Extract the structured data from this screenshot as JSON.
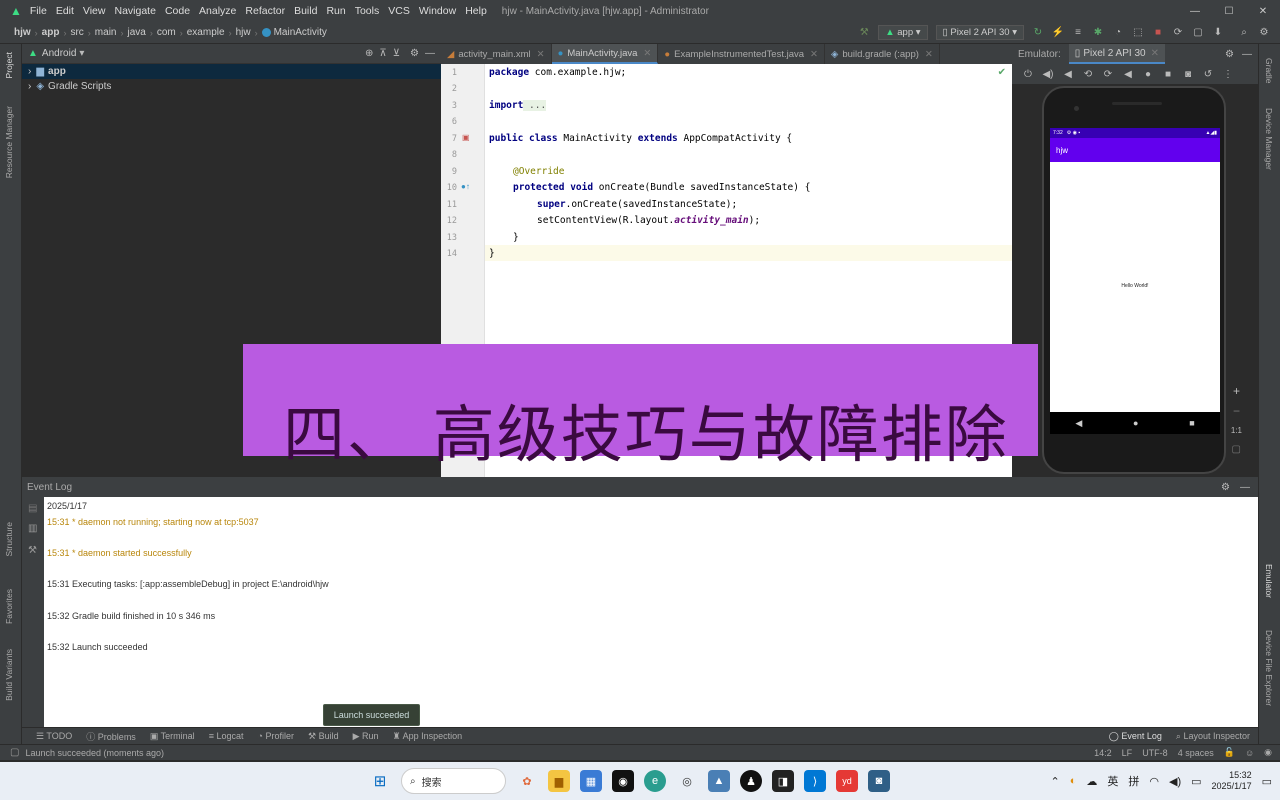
{
  "window": {
    "title": "hjw - MainActivity.java [hjw.app] - Administrator",
    "menu": [
      "File",
      "Edit",
      "View",
      "Navigate",
      "Code",
      "Analyze",
      "Refactor",
      "Build",
      "Run",
      "Tools",
      "VCS",
      "Window",
      "Help"
    ],
    "min": "—",
    "max": "☐",
    "close": "✕"
  },
  "breadcrumb": [
    "hjw",
    "app",
    "src",
    "main",
    "java",
    "com",
    "example",
    "hjw",
    "MainActivity"
  ],
  "toolbar": {
    "config": "app",
    "device": "Pixel 2 API 30"
  },
  "left_tabs": [
    "Project",
    "Resource Manager",
    "Structure",
    "Favorites",
    "Build Variants"
  ],
  "right_tabs": [
    "Gradle",
    "Device Manager",
    "Emulator",
    "Device File Explorer"
  ],
  "project": {
    "view": "Android",
    "items": [
      "app",
      "Gradle Scripts"
    ]
  },
  "editor_tabs": [
    "activity_main.xml",
    "MainActivity.java",
    "ExampleInstrumentedTest.java",
    "build.gradle (:app)"
  ],
  "code": {
    "line_numbers": [
      "1",
      "2",
      "3",
      "6",
      "7",
      "8",
      "9",
      "10",
      "11",
      "12",
      "13",
      "14"
    ],
    "l1_kw": "package",
    "l1_rest": " com.example.hjw;",
    "l3_kw": "import",
    "l3_rest": " ...",
    "l7_kw": "public class",
    "l7_mid": " MainActivity ",
    "l7_kw2": "extends",
    "l7_rest": " AppCompatActivity {",
    "l9_ann": "@Override",
    "l10_kw": "protected void",
    "l10_rest": " onCreate(Bundle savedInstanceState) {",
    "l11_kw": "super",
    "l11_rest": ".onCreate(savedInstanceState);",
    "l12_pre": "setContentView(R.layout.",
    "l12_it": "activity_main",
    "l12_post": ");",
    "l13": "}",
    "l14": "}"
  },
  "emulator": {
    "label": "Emulator:",
    "tab": "Pixel 2 API 30",
    "status_time": "7:32",
    "app_title": "hjw",
    "center_text": "Hello World!",
    "zoom": "1:1"
  },
  "overlay_text": "四、 高级技巧与故障排除",
  "event_log": {
    "title": "Event Log",
    "lines": [
      {
        "text": "2025/1/17",
        "type": "normal"
      },
      {
        "text": "15:31  * daemon not running; starting now at tcp:5037",
        "type": "warn"
      },
      {
        "text": "15:31  * daemon started successfully",
        "type": "warn"
      },
      {
        "text": "15:31  Executing tasks: [:app:assembleDebug] in project E:\\android\\hjw",
        "type": "normal"
      },
      {
        "text": "15:32  Gradle build finished in 10 s 346 ms",
        "type": "normal"
      },
      {
        "text": "15:32  Launch succeeded",
        "type": "normal"
      }
    ]
  },
  "tooltip": "Launch succeeded",
  "bottom_tabs": [
    "TODO",
    "Problems",
    "Terminal",
    "Logcat",
    "Profiler",
    "Build",
    "Run",
    "App Inspection"
  ],
  "bottom_right_tabs": [
    "Event Log",
    "Layout Inspector"
  ],
  "status": {
    "message": "Launch succeeded (moments ago)",
    "position": "14:2",
    "line_sep": "LF",
    "encoding": "UTF-8",
    "indent": "4 spaces"
  },
  "taskbar": {
    "search": "搜索",
    "ime1": "英",
    "ime2": "拼",
    "time": "15:32",
    "date": "2025/1/17"
  }
}
